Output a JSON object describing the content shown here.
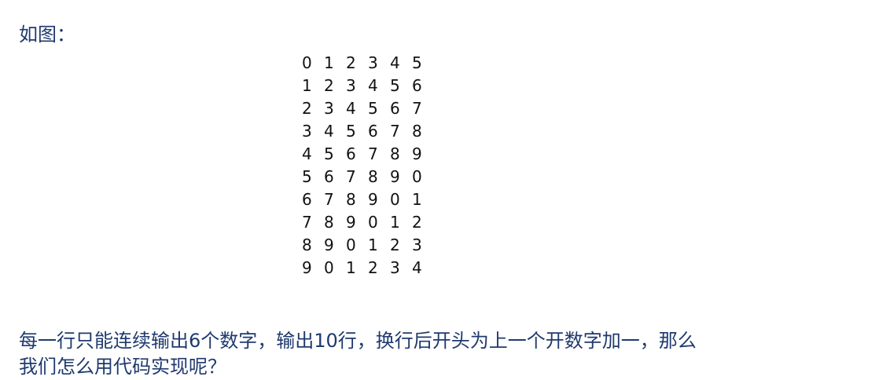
{
  "heading": "如图：",
  "grid": [
    [
      "0",
      "1",
      "2",
      "3",
      "4",
      "5"
    ],
    [
      "1",
      "2",
      "3",
      "4",
      "5",
      "6"
    ],
    [
      "2",
      "3",
      "4",
      "5",
      "6",
      "7"
    ],
    [
      "3",
      "4",
      "5",
      "6",
      "7",
      "8"
    ],
    [
      "4",
      "5",
      "6",
      "7",
      "8",
      "9"
    ],
    [
      "5",
      "6",
      "7",
      "8",
      "9",
      "0"
    ],
    [
      "6",
      "7",
      "8",
      "9",
      "0",
      "1"
    ],
    [
      "7",
      "8",
      "9",
      "0",
      "1",
      "2"
    ],
    [
      "8",
      "9",
      "0",
      "1",
      "2",
      "3"
    ],
    [
      "9",
      "0",
      "1",
      "2",
      "3",
      "4"
    ]
  ],
  "question": {
    "line1": "每一行只能连续输出6个数字，输出10行，换行后开头为上一个开数字加一，那么",
    "line2": "我们怎么用代码实现呢？"
  },
  "colors": {
    "text": "#1f3a6e",
    "digits": "#111111"
  }
}
